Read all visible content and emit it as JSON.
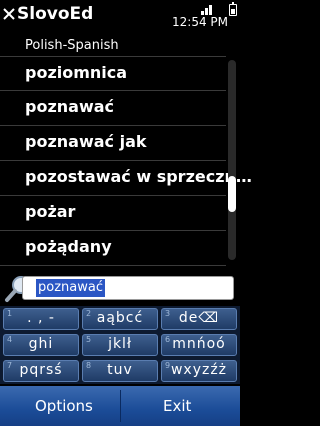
{
  "app": {
    "title": "SlovoEd",
    "time": "12:54 PM",
    "dictionary": "Polish-Spanish"
  },
  "list": {
    "items": [
      "poziomnica",
      "poznawać",
      "poznawać jak",
      "pozostawać w sprzeczn…",
      "pożar",
      "pożądany"
    ]
  },
  "search": {
    "value": "poznawać"
  },
  "keypad": {
    "keys": [
      {
        "num": "1",
        "chars": ". , -"
      },
      {
        "num": "2",
        "chars": "aąbcć"
      },
      {
        "num": "3",
        "chars": "de⌫"
      },
      {
        "num": "4",
        "chars": "ghi"
      },
      {
        "num": "5",
        "chars": "jklł"
      },
      {
        "num": "6",
        "chars": "mnńoó"
      },
      {
        "num": "7",
        "chars": "pqrsś"
      },
      {
        "num": "8",
        "chars": "tuv"
      },
      {
        "num": "9",
        "chars": "wxyzźż"
      }
    ]
  },
  "softkeys": {
    "left": "Options",
    "right": "Exit"
  },
  "icons": {
    "close": "close-icon",
    "signal": "signal-icon",
    "battery": "battery-icon",
    "search": "search-icon"
  },
  "colors": {
    "background": "#000000",
    "selection": "#2b56c4",
    "softkey_bar": "#1b4c98",
    "keypad_key": "#2f5080"
  }
}
